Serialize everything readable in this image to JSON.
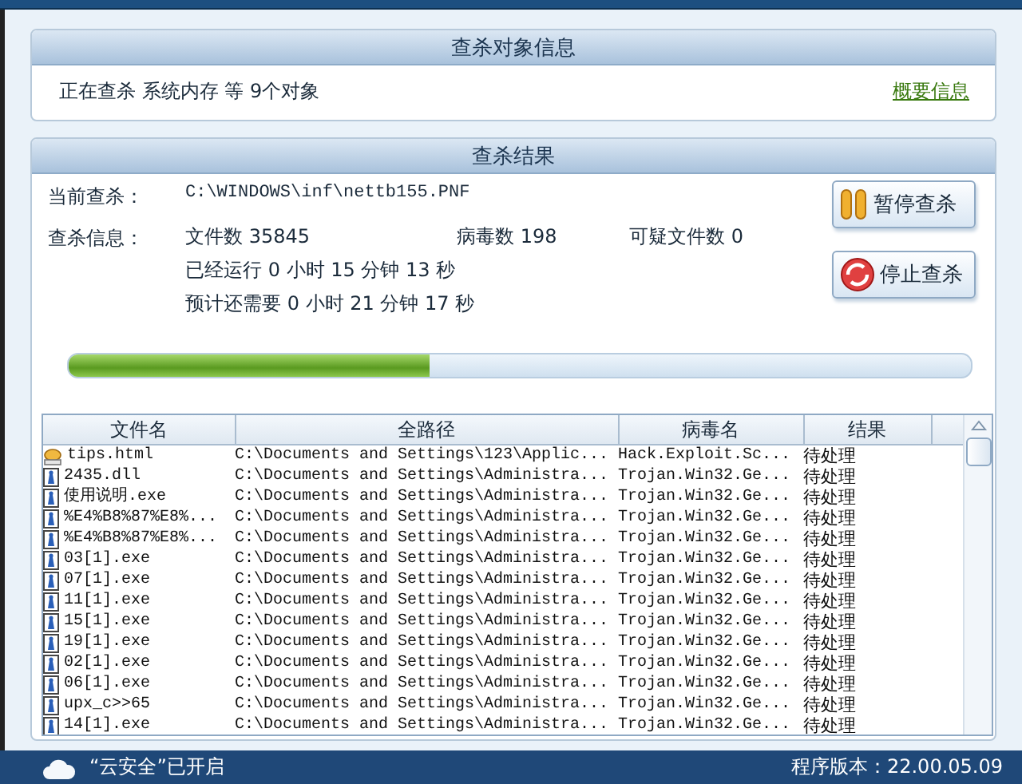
{
  "target_panel": {
    "title": "查杀对象信息",
    "status": "正在查杀  系统内存  等  9个对象",
    "link": "概要信息"
  },
  "result_panel": {
    "title": "查杀结果",
    "current_label": "当前查杀：",
    "current_path": "C:\\WINDOWS\\inf\\nettb155.PNF",
    "info_label": "查杀信息：",
    "files": "文件数 35845",
    "viruses": "病毒数 198",
    "suspicious": "可疑文件数 0",
    "elapsed": "已经运行 0 小时 15 分钟 13  秒",
    "remaining": "预计还需要 0 小时 21 分钟 17  秒",
    "buttons": [
      {
        "kind": "pause",
        "label": "暂停查杀"
      },
      {
        "kind": "stop",
        "label": "停止查杀"
      }
    ],
    "progress": {
      "level": 0.4
    },
    "table": {
      "columns": [
        "文件名",
        "全路径",
        "病毒名",
        "结果"
      ],
      "rows": [
        {
          "kind": "script",
          "cells": [
            "tips.html",
            "C:\\Documents and Settings\\123\\Applic...",
            "Hack.Exploit.Sc...",
            "待处理"
          ]
        },
        {
          "kind": "file",
          "cells": [
            "2435.dll",
            "C:\\Documents and Settings\\Administra...",
            "Trojan.Win32.Ge...",
            "待处理"
          ]
        },
        {
          "kind": "file",
          "cells": [
            "使用说明.exe",
            "C:\\Documents and Settings\\Administra...",
            "Trojan.Win32.Ge...",
            "待处理"
          ]
        },
        {
          "kind": "file",
          "cells": [
            "%E4%B8%87%E8%...",
            "C:\\Documents and Settings\\Administra...",
            "Trojan.Win32.Ge...",
            "待处理"
          ]
        },
        {
          "kind": "file",
          "cells": [
            "%E4%B8%87%E8%...",
            "C:\\Documents and Settings\\Administra...",
            "Trojan.Win32.Ge...",
            "待处理"
          ]
        },
        {
          "kind": "file",
          "cells": [
            "03[1].exe",
            "C:\\Documents and Settings\\Administra...",
            "Trojan.Win32.Ge...",
            "待处理"
          ]
        },
        {
          "kind": "file",
          "cells": [
            "07[1].exe",
            "C:\\Documents and Settings\\Administra...",
            "Trojan.Win32.Ge...",
            "待处理"
          ]
        },
        {
          "kind": "file",
          "cells": [
            "11[1].exe",
            "C:\\Documents and Settings\\Administra...",
            "Trojan.Win32.Ge...",
            "待处理"
          ]
        },
        {
          "kind": "file",
          "cells": [
            "15[1].exe",
            "C:\\Documents and Settings\\Administra...",
            "Trojan.Win32.Ge...",
            "待处理"
          ]
        },
        {
          "kind": "file",
          "cells": [
            "19[1].exe",
            "C:\\Documents and Settings\\Administra...",
            "Trojan.Win32.Ge...",
            "待处理"
          ]
        },
        {
          "kind": "file",
          "cells": [
            "02[1].exe",
            "C:\\Documents and Settings\\Administra...",
            "Trojan.Win32.Ge...",
            "待处理"
          ]
        },
        {
          "kind": "file",
          "cells": [
            "06[1].exe",
            "C:\\Documents and Settings\\Administra...",
            "Trojan.Win32.Ge...",
            "待处理"
          ]
        },
        {
          "kind": "file",
          "cells": [
            "upx_c>>65",
            "C:\\Documents and Settings\\Administra...",
            "Trojan.Win32.Ge...",
            "待处理"
          ]
        },
        {
          "kind": "file",
          "cells": [
            "14[1].exe",
            "C:\\Documents and Settings\\Administra...",
            "Trojan.Win32.Ge...",
            "待处理"
          ]
        }
      ]
    }
  },
  "status_bar": {
    "cloud": "“云安全”已开启",
    "version": "程序版本：22.00.05.09"
  }
}
